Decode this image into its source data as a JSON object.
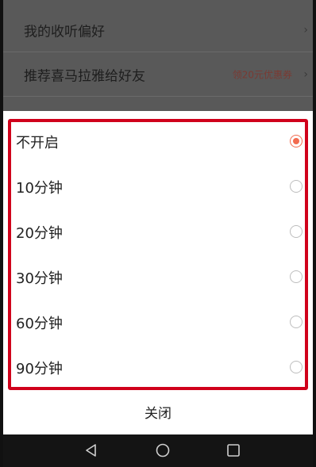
{
  "background_list": {
    "items": [
      {
        "label": "我的收听偏好",
        "promo": ""
      },
      {
        "label": "推荐喜马拉雅给好友",
        "promo": "领20元优惠券"
      }
    ]
  },
  "sheet": {
    "options": [
      {
        "label": "不开启",
        "selected": true
      },
      {
        "label": "10分钟",
        "selected": false
      },
      {
        "label": "20分钟",
        "selected": false
      },
      {
        "label": "30分钟",
        "selected": false
      },
      {
        "label": "60分钟",
        "selected": false
      },
      {
        "label": "90分钟",
        "selected": false
      }
    ],
    "close_label": "关闭"
  },
  "navbar": {
    "icons": [
      "back-icon",
      "home-icon",
      "recent-apps-icon"
    ]
  },
  "colors": {
    "accent": "#f26b4f",
    "highlight_border": "#d0011b"
  }
}
